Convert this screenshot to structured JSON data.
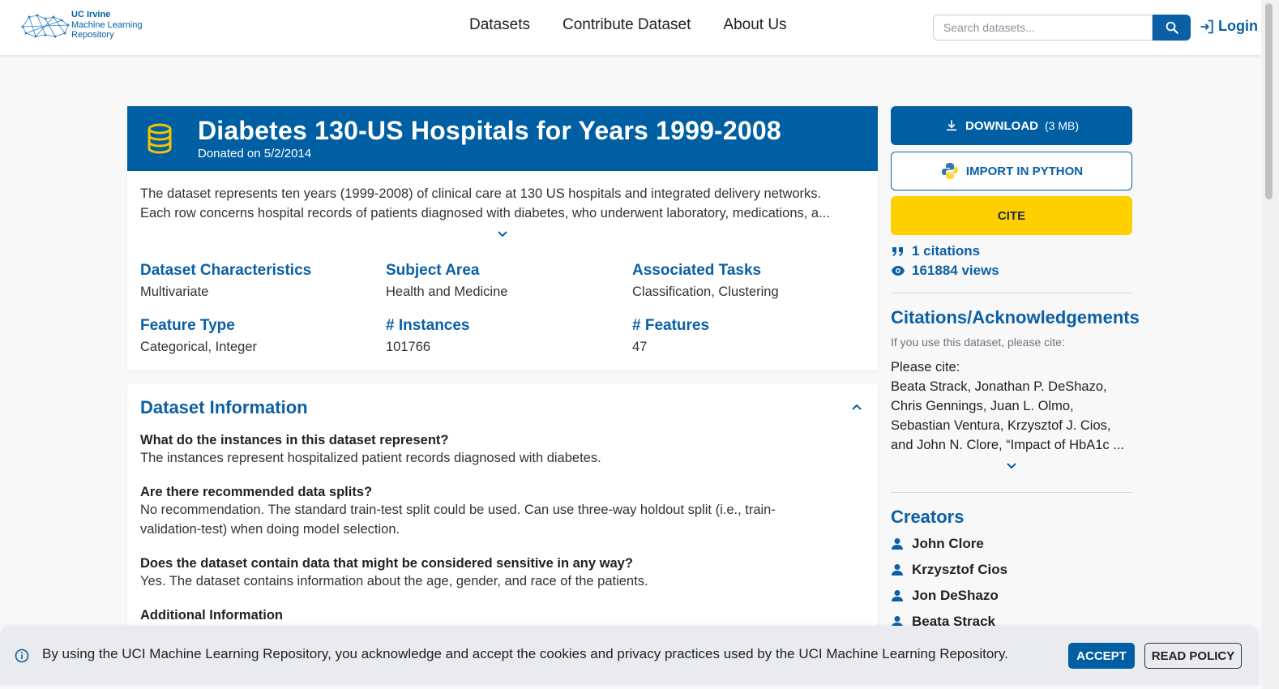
{
  "header": {
    "logo": {
      "line1": "UC Irvine",
      "line2": "Machine Learning",
      "line3": "Repository",
      "icon": "network-logo"
    },
    "nav": [
      "Datasets",
      "Contribute Dataset",
      "About Us"
    ],
    "search": {
      "placeholder": "Search datasets...",
      "value": "",
      "icon": "search-icon"
    },
    "login": {
      "label": "Login",
      "icon": "login-icon"
    }
  },
  "dataset": {
    "title": "Diabetes 130-US Hospitals for Years 1999-2008",
    "donated": "Donated on 5/2/2014",
    "icon": "database-icon",
    "summary_line1": "The dataset represents ten years (1999-2008) of clinical care at 130 US hospitals and integrated delivery networks.",
    "summary_line2": "Each row concerns hospital records of patients diagnosed with diabetes, who underwent laboratory, medications, a...",
    "characteristics": [
      {
        "label": "Dataset Characteristics",
        "value": "Multivariate"
      },
      {
        "label": "Subject Area",
        "value": "Health and Medicine"
      },
      {
        "label": "Associated Tasks",
        "value": "Classification, Clustering"
      },
      {
        "label": "Feature Type",
        "value": "Categorical, Integer"
      },
      {
        "label": "# Instances",
        "value": "101766"
      },
      {
        "label": "# Features",
        "value": "47"
      }
    ]
  },
  "info": {
    "title": "Dataset Information",
    "qa": [
      {
        "q": "What do the instances in this dataset represent?",
        "a1": "The instances represent hospitalized patient records diagnosed with diabetes.",
        "a2": ""
      },
      {
        "q": "Are there recommended data splits?",
        "a1": "No recommendation. The standard train-test split could be used. Can use three-way holdout split (i.e., train-",
        "a2": "validation-test) when doing model selection."
      },
      {
        "q": "Does the dataset contain data that might be considered sensitive in any way?",
        "a1": "Yes. The dataset contains information about the age, gender, and race of the patients.",
        "a2": ""
      },
      {
        "q": "Additional Information",
        "a1": "",
        "a2": ""
      }
    ]
  },
  "sidebar": {
    "download_label": "DOWNLOAD",
    "download_size": "(3 MB)",
    "python_label": "IMPORT IN PYTHON",
    "cite_label": "CITE",
    "citations": "1 citations",
    "views": "161884 views",
    "citations_title": "Citations/Acknowledgements",
    "citations_note": "If you use this dataset, please cite:",
    "cite_lines": [
      "Please cite:",
      "Beata Strack, Jonathan P. DeShazo,",
      "Chris Gennings, Juan L. Olmo,",
      "Sebastian Ventura, Krzysztof J. Cios,",
      "and John N. Clore, “Impact of HbA1c ..."
    ],
    "creators_title": "Creators",
    "creators": [
      "John Clore",
      "Krzysztof Cios",
      "Jon DeShazo",
      "Beata Strack"
    ]
  },
  "cookie": {
    "text": "By using the UCI Machine Learning Repository, you acknowledge and accept the cookies and privacy practices used by the UCI Machine Learning Repository.",
    "accept": "ACCEPT",
    "policy": "READ POLICY"
  },
  "colors": {
    "primary": "#005fa3",
    "cite": "#ffd000",
    "background": "#f8f8f8"
  }
}
